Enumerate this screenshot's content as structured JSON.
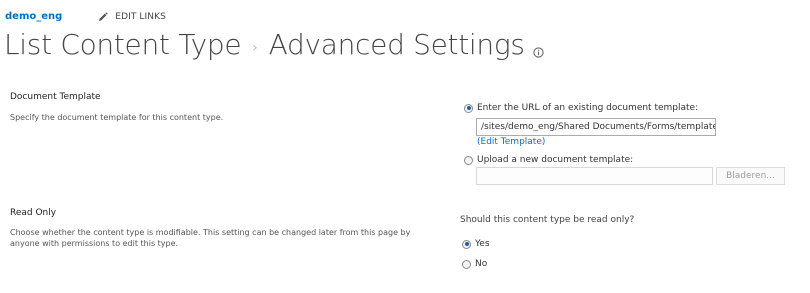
{
  "header": {
    "site_name": "demo_eng",
    "edit_links_label": "EDIT LINKS"
  },
  "title": {
    "part1": "List Content Type",
    "separator": "›",
    "part2": "Advanced Settings"
  },
  "document_template": {
    "label": "Document Template",
    "description": "Specify the document template for this content type.",
    "option_url_label": "Enter the URL of an existing document template:",
    "url_value": "/sites/demo_eng/Shared Documents/Forms/template",
    "edit_template_link": "(Edit Template)",
    "option_upload_label": "Upload a new document template:",
    "upload_value": "",
    "browse_button": "Bladeren...",
    "selected": "url"
  },
  "read_only": {
    "label": "Read Only",
    "description_line1": "Choose whether the content type is modifiable. This setting can be changed later from this page by",
    "description_line2": "anyone with permissions to edit this type.",
    "question": "Should this content type be read only?",
    "option_yes": "Yes",
    "option_no": "No",
    "selected": "yes"
  },
  "icons": {
    "edit_links": "pencil-icon",
    "title_info": "info-icon"
  },
  "colors": {
    "link": "#0072c6",
    "title": "#444444",
    "radio_selected": "#1c5fa8"
  }
}
